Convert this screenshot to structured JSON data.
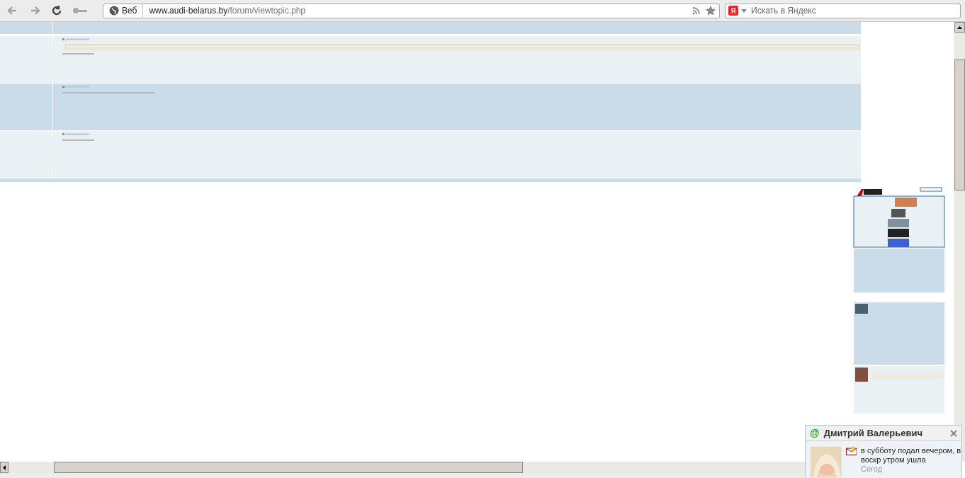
{
  "toolbar": {
    "web_button": "Веб",
    "url": {
      "host": "www.audi-belarus.by",
      "path": "/forum/viewtopic.php"
    },
    "search": {
      "engine_letter": "Я",
      "placeholder": "Искать в Яндекс"
    }
  },
  "posts": [
    {
      "highlighted": false,
      "quote": true
    },
    {
      "highlighted": true,
      "quote": false
    },
    {
      "highlighted": false,
      "quote": false
    }
  ],
  "notification": {
    "icon": "@",
    "sender": "Дмитрий Валерьевич",
    "message": "в субботу подал вечером, в воскр утром ушла",
    "time": "Сегод"
  }
}
